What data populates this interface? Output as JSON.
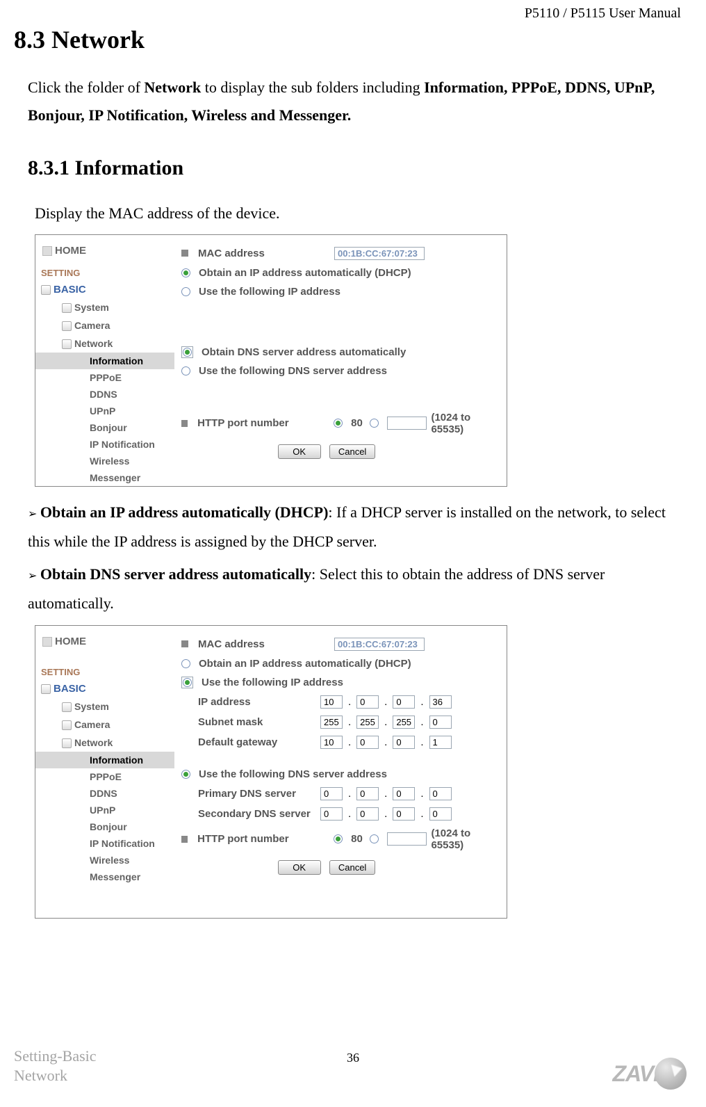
{
  "header": {
    "manual": "P5110 / P5115 User Manual"
  },
  "section": {
    "number": "8.3",
    "title": "Network"
  },
  "intro": {
    "prefix": "Click the folder of ",
    "bold1": "Network",
    "mid": " to display the sub folders including ",
    "bold2": "Information, PPPoE, DDNS, UPnP, Bonjour, IP Notification, Wireless and Messenger."
  },
  "subsection": {
    "number": "8.3.1",
    "title": "Information"
  },
  "line1": "Display the MAC address of the device.",
  "panel1": {
    "sidebar": {
      "home": "HOME",
      "setting": "SETTING",
      "basic": "BASIC",
      "items": [
        {
          "label": "System",
          "expandable": true
        },
        {
          "label": "Camera",
          "expandable": true
        },
        {
          "label": "Network",
          "expandable": true
        }
      ],
      "subs": [
        {
          "label": "Information",
          "active": true
        },
        {
          "label": "PPPoE"
        },
        {
          "label": "DDNS"
        },
        {
          "label": "UPnP"
        },
        {
          "label": "Bonjour"
        },
        {
          "label": "IP Notification"
        },
        {
          "label": "Wireless"
        },
        {
          "label": "Messenger"
        }
      ]
    },
    "form": {
      "mac_label": "MAC address",
      "mac_value": "00:1B:CC:67:07:23",
      "ip_auto": "Obtain an IP address automatically (DHCP)",
      "ip_static": "Use the following IP address",
      "dns_auto": "Obtain DNS server address automatically",
      "dns_static": "Use the following DNS server address",
      "http_label": "HTTP port number",
      "http80": "80",
      "http_hint": "(1024 to 65535)",
      "ok": "OK",
      "cancel": "Cancel"
    }
  },
  "para1": {
    "bold": "Obtain an IP address automatically (DHCP)",
    "rest": ": If a DHCP server is installed on the network, to select this while the IP address is assigned by the DHCP server."
  },
  "para2": {
    "bold": "Obtain DNS server address automatically",
    "rest": ": Select this to obtain the address of DNS server automatically."
  },
  "panel2": {
    "sidebar": {
      "home": "HOME",
      "setting": "SETTING",
      "basic": "BASIC",
      "items": [
        {
          "label": "System",
          "expandable": true
        },
        {
          "label": "Camera",
          "expandable": true
        },
        {
          "label": "Network",
          "expandable": true
        }
      ],
      "subs": [
        {
          "label": "Information",
          "active": true
        },
        {
          "label": "PPPoE"
        },
        {
          "label": "DDNS"
        },
        {
          "label": "UPnP"
        },
        {
          "label": "Bonjour"
        },
        {
          "label": "IP Notification"
        },
        {
          "label": "Wireless"
        },
        {
          "label": "Messenger"
        }
      ]
    },
    "form": {
      "mac_label": "MAC address",
      "mac_value": "00:1B:CC:67:07:23",
      "ip_auto": "Obtain an IP address automatically (DHCP)",
      "ip_static": "Use the following IP address",
      "ip_label": "IP address",
      "ip": [
        "10",
        "0",
        "0",
        "36"
      ],
      "mask_label": "Subnet mask",
      "mask": [
        "255",
        "255",
        "255",
        "0"
      ],
      "gw_label": "Default gateway",
      "gw": [
        "10",
        "0",
        "0",
        "1"
      ],
      "dns_static": "Use the following DNS server address",
      "pdns_label": "Primary DNS server",
      "pdns": [
        "0",
        "0",
        "0",
        "0"
      ],
      "sdns_label": "Secondary DNS server",
      "sdns": [
        "0",
        "0",
        "0",
        "0"
      ],
      "http_label": "HTTP port number",
      "http80": "80",
      "http_hint": "(1024 to 65535)",
      "ok": "OK",
      "cancel": "Cancel"
    }
  },
  "footer": {
    "left1": "Setting-Basic",
    "left2": "Network",
    "page": "36",
    "logo": "ZAVI"
  }
}
